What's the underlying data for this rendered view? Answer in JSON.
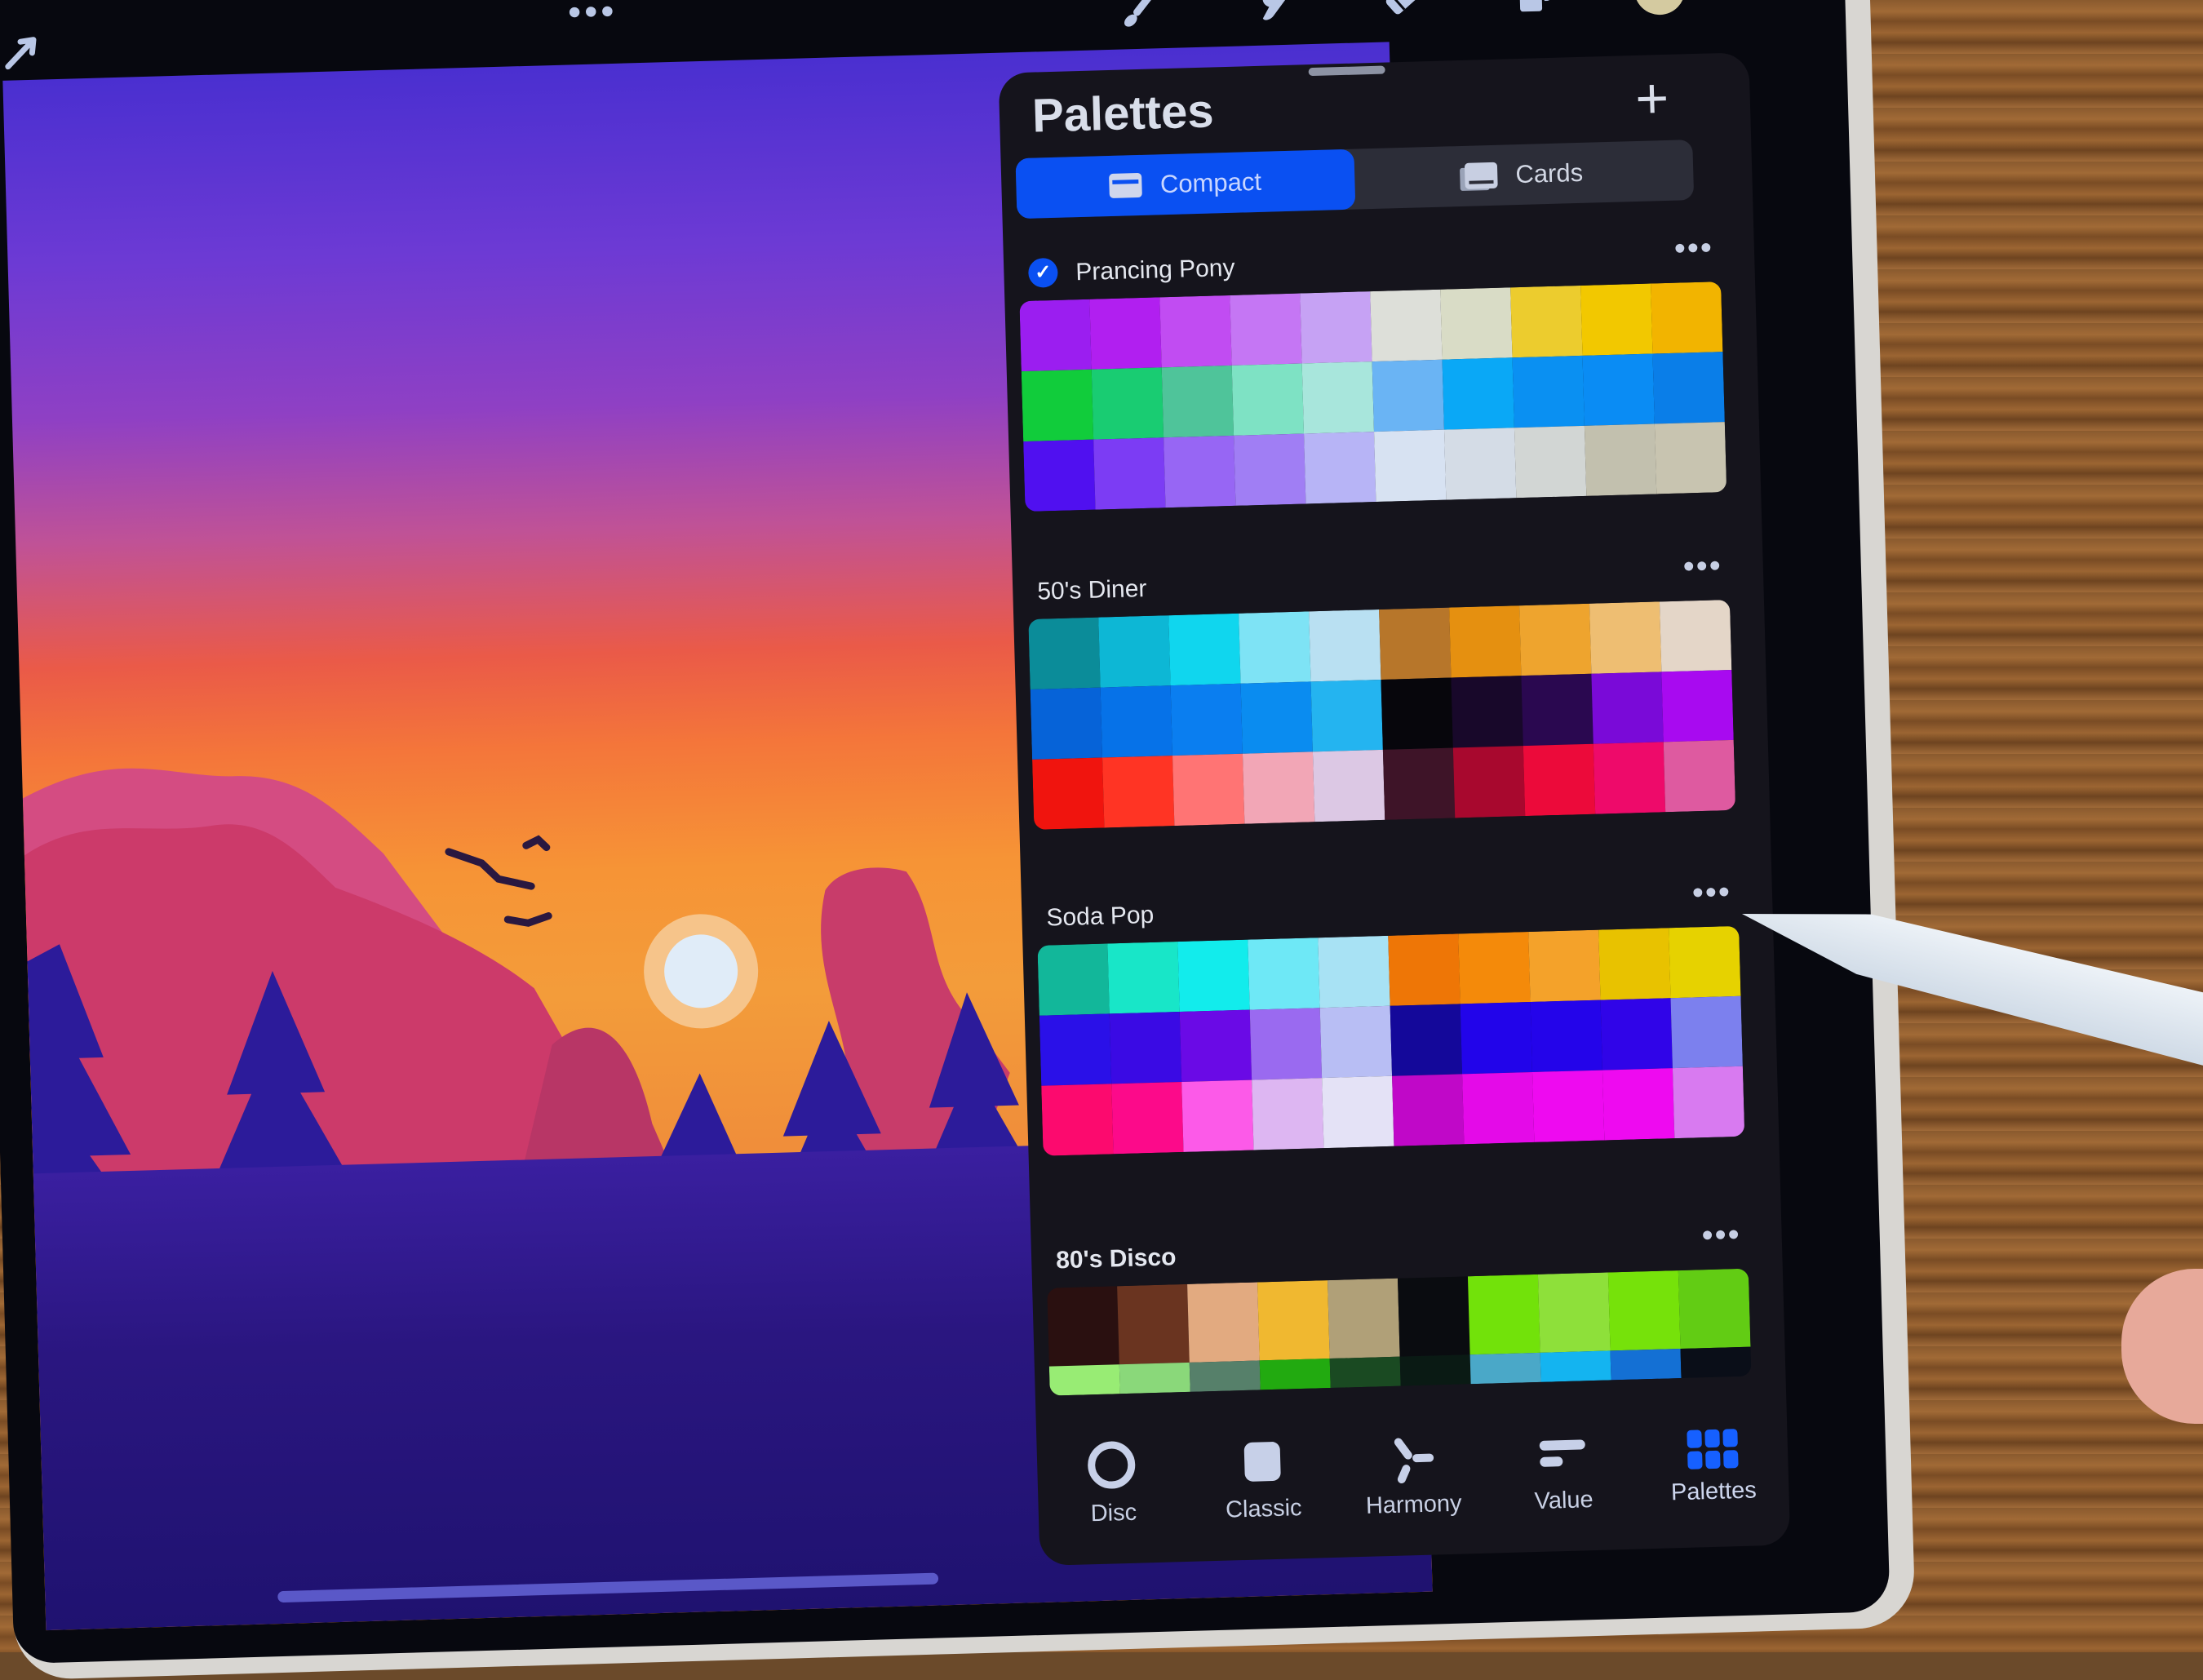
{
  "toolbar": {
    "left": {
      "actions_icon": "arrow-icon",
      "more_label": "•••"
    },
    "tools": [
      {
        "name": "brush",
        "icon": "brush-icon"
      },
      {
        "name": "smudge",
        "icon": "smudge-icon"
      },
      {
        "name": "eraser",
        "icon": "eraser-icon"
      },
      {
        "name": "layers",
        "icon": "layers-icon"
      }
    ],
    "current_color": "#d4caa0"
  },
  "panel": {
    "title": "Palettes",
    "add_label": "+",
    "segments": [
      {
        "label": "Compact",
        "icon": "compact-icon",
        "active": true
      },
      {
        "label": "Cards",
        "icon": "cards-icon",
        "active": false
      }
    ],
    "palettes": [
      {
        "name": "Prancing Pony",
        "default": true,
        "more_label": "•••",
        "colors": [
          "#9b1ef0",
          "#b11ff0",
          "#c14cf2",
          "#c576f4",
          "#c6a2f4",
          "#dddfd9",
          "#d9dcc6",
          "#eccc2e",
          "#f2c800",
          "#f2b400",
          "#11cc3b",
          "#19cc72",
          "#4fc49a",
          "#7ee2c4",
          "#a8e6dc",
          "#6ab4f4",
          "#0aa8f6",
          "#0a90f2",
          "#0a8cf4",
          "#0a7ee8",
          "#5010f0",
          "#7c3cf4",
          "#9766f4",
          "#a07ef4",
          "#b7b4f6",
          "#d7e2f2",
          "#d4dce6",
          "#d2d6d4",
          "#c2c0ae",
          "#c8c4b0"
        ]
      },
      {
        "name": "50's Diner",
        "default": false,
        "more_label": "•••",
        "colors": [
          "#0b8c99",
          "#0db7d5",
          "#10d6ee",
          "#7ee3f5",
          "#b9e0f2",
          "#b7762a",
          "#e59010",
          "#eea42e",
          "#eebe72",
          "#e4d6c8",
          "#0663d8",
          "#0672e8",
          "#0a7ef0",
          "#0a8cf0",
          "#24b4f0",
          "#07060c",
          "#18082a",
          "#2a0850",
          "#7a0ad8",
          "#a80af0",
          "#f0140e",
          "#ff3424",
          "#ff7474",
          "#f2a6b6",
          "#dcc8e4",
          "#3e1428",
          "#a8082e",
          "#ec0a3a",
          "#ee0a6a",
          "#de5aa0"
        ]
      },
      {
        "name": "Soda Pop",
        "default": false,
        "more_label": "•••",
        "colors": [
          "#12b79a",
          "#18e6c8",
          "#12ecec",
          "#6ee8f6",
          "#a8e2f4",
          "#ee7606",
          "#f48a0a",
          "#f4a22a",
          "#e8c200",
          "#e6d200",
          "#2a10e8",
          "#3a0ae4",
          "#6a0ae6",
          "#9a6af0",
          "#b8bef4",
          "#14089a",
          "#2204ea",
          "#2404ea",
          "#3004e8",
          "#7c80ee",
          "#fc0a6e",
          "#fc0a8a",
          "#fc5ae8",
          "#ddb6f2",
          "#e4e2f6",
          "#c008c8",
          "#e40ae8",
          "#ee0af0",
          "#ee0af0",
          "#d87af0"
        ]
      },
      {
        "name": "80's Disco",
        "default": false,
        "more_label": "•••",
        "colors": [
          "#2a1010",
          "#6a3420",
          "#e2aa80",
          "#f0b830",
          "#b0a078",
          "#0a0c10",
          "#72e20a",
          "#8ee03a",
          "#76e20a",
          "#62cc14",
          "#98ec74",
          "#8ad87a",
          "#56806a",
          "#22aa10",
          "#1a4a22",
          "#0a1a14",
          "#4aa8c8",
          "#14b4f0",
          "#1470d4",
          "#0a0e18"
        ]
      }
    ]
  },
  "tabbar": {
    "tabs": [
      {
        "label": "Disc",
        "icon": "disc-icon",
        "active": false
      },
      {
        "label": "Classic",
        "icon": "classic-icon",
        "active": false
      },
      {
        "label": "Harmony",
        "icon": "harmony-icon",
        "active": false
      },
      {
        "label": "Value",
        "icon": "value-icon",
        "active": false
      },
      {
        "label": "Palettes",
        "icon": "palettes-icon",
        "active": true
      }
    ]
  }
}
